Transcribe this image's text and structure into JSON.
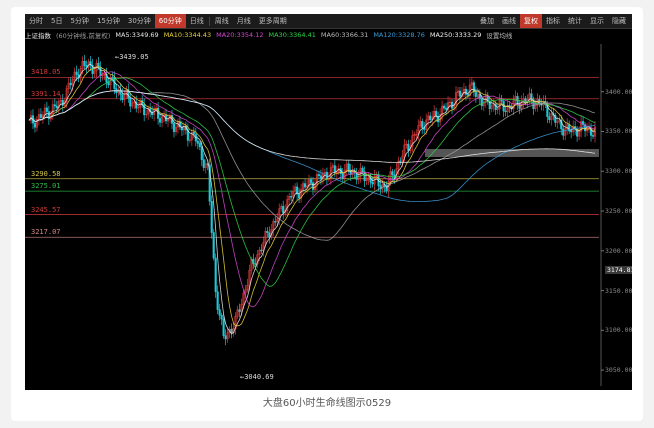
{
  "toolbar": {
    "items": [
      "分时",
      "5日",
      "5分钟",
      "15分钟",
      "30分钟",
      "60分钟",
      "日线",
      "周线",
      "月线",
      "更多周期",
      "叠加",
      "画线",
      "复权",
      "指标",
      "统计",
      "显示",
      "隐藏"
    ],
    "active_index": 5,
    "sections": [
      "叠加",
      "画线",
      "指标",
      "统计",
      "显示",
      "隐藏"
    ]
  },
  "ma_bar": {
    "index_name": "上证指数",
    "period": "(60分钟线,前复权)",
    "ma5": "MA5:3349.69",
    "ma10": "MA10:3344.43",
    "ma20": "MA20:3354.12",
    "ma30": "MA30:3364.41",
    "ma60": "MA60:3366.31",
    "ma120": "MA120:3328.76",
    "ma250": "MA250:3333.29",
    "extra": "设置均线"
  },
  "price_levels": [
    {
      "label": "3418.05",
      "value": 3418.05,
      "color": "#d23a3a"
    },
    {
      "label": "3391.14",
      "value": 3391.14,
      "color": "#d23a3a"
    },
    {
      "label": "3290.58",
      "value": 3290.58,
      "color": "#d9c84a"
    },
    {
      "label": "3275.01",
      "value": 3275.01,
      "color": "#2fbf4a"
    },
    {
      "label": "3245.57",
      "value": 3245.57,
      "color": "#d23a3a"
    },
    {
      "label": "3217.07",
      "value": 3217.07,
      "color": "#d48a8a"
    }
  ],
  "y_axis": {
    "ticks": [
      "3400.00",
      "3350.00",
      "3300.00",
      "3250.00",
      "3200.00",
      "3150.00",
      "3100.00",
      "3050.00"
    ],
    "tick_values": [
      3400,
      3350,
      3300,
      3250,
      3200,
      3150,
      3100,
      3050
    ],
    "current_price": "3174.81",
    "ylim": [
      3030,
      3460
    ]
  },
  "markers": {
    "high": "3439.05",
    "low": "3040.69"
  },
  "colors": {
    "up": "#e23b3b",
    "down": "#1fc8d8",
    "ma5": "#e8e8e8",
    "ma10": "#e8d23a",
    "ma20": "#d24ad2",
    "ma30": "#2fd24a",
    "ma60": "#a0a0a0",
    "ma120": "#3a9ad8",
    "ma250": "#f0f0f0"
  },
  "caption": "大盘60小时生命线图示0529"
}
